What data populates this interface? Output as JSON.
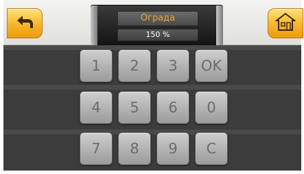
{
  "header": {
    "title": "Ограда",
    "value": "150 %"
  },
  "buttons": {
    "back_icon": "back-arrow-icon",
    "home_icon": "home-icon",
    "accent_color": "#f7b52a"
  },
  "keypad": {
    "rows": [
      [
        "1",
        "2",
        "3",
        "OK"
      ],
      [
        "4",
        "5",
        "6",
        "0"
      ],
      [
        "7",
        "8",
        "9",
        "C"
      ]
    ]
  }
}
